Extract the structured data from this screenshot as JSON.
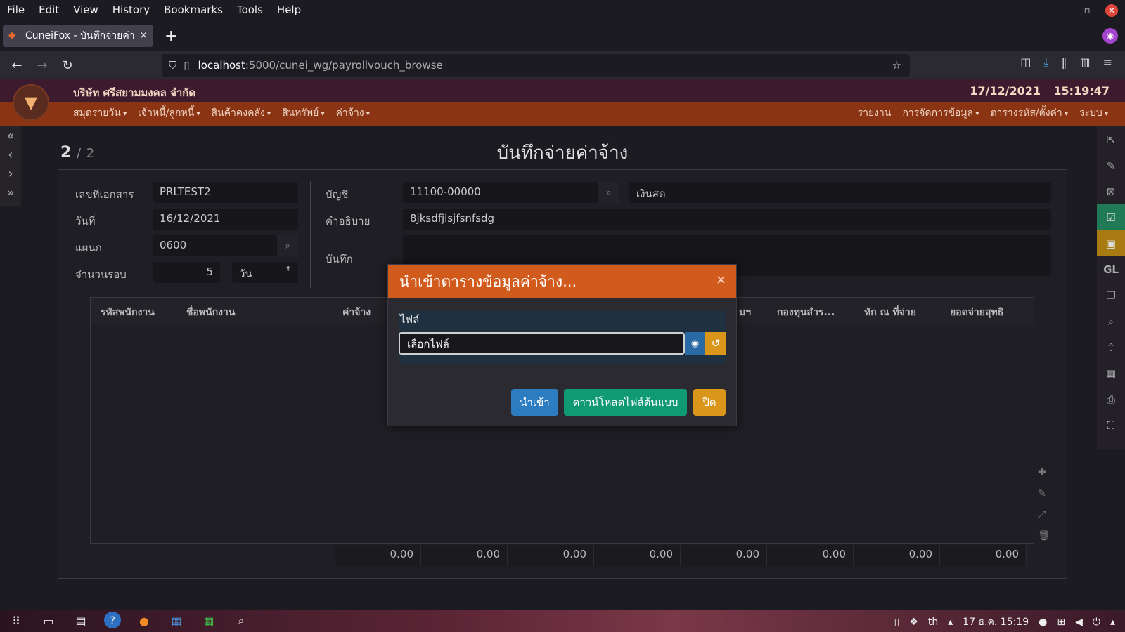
{
  "browser": {
    "menu": [
      "File",
      "Edit",
      "View",
      "History",
      "Bookmarks",
      "Tools",
      "Help"
    ],
    "tab_title": "CuneiFox - บันทึกจ่ายค่าจ้า",
    "url_host": "localhost",
    "url_path": ":5000/cunei_wg/payrollvouch_browse"
  },
  "app": {
    "company": "บริษัท ศรีสยามมงคล จำกัด",
    "date": "17/12/2021",
    "time": "15:19:47",
    "menu_left": [
      "สมุดรายวัน",
      "เจ้าหนี้/ลูกหนี้",
      "สินค้าคงคลัง",
      "สินทรัพย์",
      "ค่าจ้าง"
    ],
    "menu_right": [
      "รายงาน",
      "การจัดการข้อมูล",
      "ตารางรหัส/ตั้งค่า",
      "ระบบ"
    ]
  },
  "page": {
    "record": "2",
    "record_sep": "/",
    "record_total": "2",
    "title": "บันทึกจ่ายค่าจ้าง"
  },
  "form": {
    "doc_no_label": "เลขที่เอกสาร",
    "doc_no": "PRLTEST2",
    "date_label": "วันที่",
    "date": "16/12/2021",
    "dept_label": "แผนก",
    "dept": "0600",
    "rounds_label": "จำนวนรอบ",
    "rounds": "5",
    "rounds_unit": "วัน",
    "account_label": "บัญชี",
    "account": "11100-00000",
    "account_name": "เงินสด",
    "desc_label": "คำอธิบาย",
    "desc": "8jksdfjlsjfsnfsdg",
    "note_label": "บันทึก"
  },
  "grid": {
    "headers": [
      "รหัสพนักงาน",
      "ชื่อพนักงาน",
      "ค่าจ้าง",
      "มฯ",
      "กองทุนสำร...",
      "หัก ณ ที่จ่าย",
      "ยอดจ่ายสุทธิ"
    ],
    "totals": [
      "0.00",
      "0.00",
      "0.00",
      "0.00",
      "0.00",
      "0.00",
      "0.00",
      "0.00"
    ]
  },
  "modal": {
    "title": "นำเข้าตารางข้อมูลค่าจ้าง...",
    "close": "×",
    "file_label": "ไฟล์",
    "file_placeholder": "เลือกไฟล์",
    "import_btn": "นำเข้า",
    "download_btn": "ดาวน์โหลดไฟล์ต้นแบบ",
    "close_btn": "ปิด"
  },
  "taskbar": {
    "lang": "th",
    "datetime": "17 ธ.ค. 15:19"
  },
  "colors": {
    "app_menu": "#8a3413",
    "modal_header": "#d15a1d",
    "import": "#2c7cc1",
    "download": "#0f9a73",
    "close": "#d9961b"
  }
}
